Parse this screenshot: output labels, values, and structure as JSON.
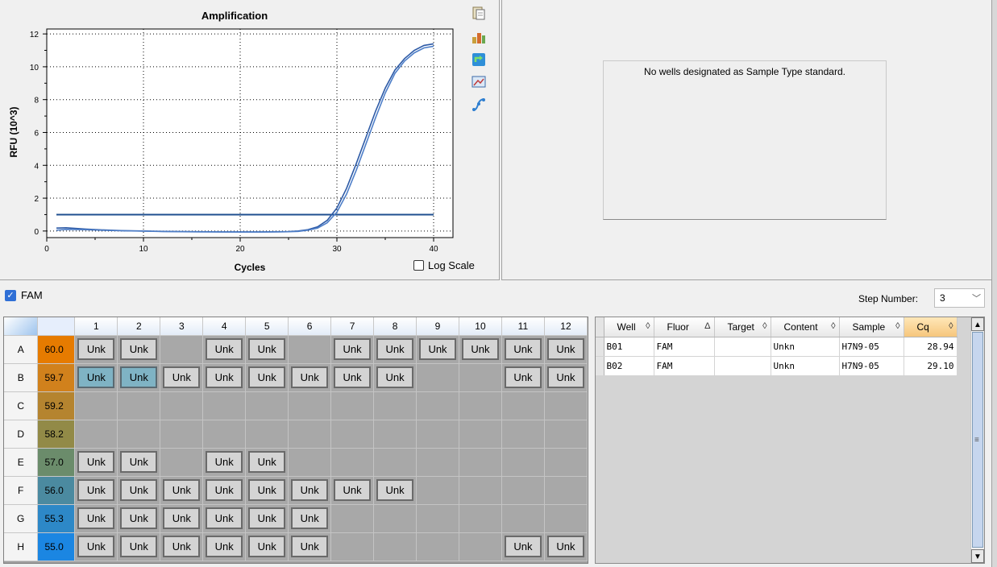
{
  "chart_data": {
    "type": "line",
    "title": "Amplification",
    "xlabel": "Cycles",
    "ylabel": "RFU (10^3)",
    "xlim": [
      0,
      42
    ],
    "ylim": [
      -0.4,
      12.3
    ],
    "xticks": [
      0,
      10,
      20,
      30,
      40
    ],
    "yticks": [
      0,
      2,
      4,
      6,
      8,
      10,
      12
    ],
    "grid": "dotted",
    "threshold": 1.0,
    "threshold_x": [
      1,
      40
    ],
    "series": [
      {
        "color": "#2d5aa6",
        "x": [
          1,
          2,
          4,
          6,
          8,
          10,
          12,
          14,
          16,
          18,
          20,
          22,
          24,
          25,
          26,
          27,
          28,
          29,
          30,
          31,
          32,
          33,
          34,
          35,
          36,
          37,
          38,
          39,
          40
        ],
        "values": [
          0.18,
          0.2,
          0.12,
          0.06,
          0.02,
          0.0,
          -0.02,
          -0.03,
          -0.04,
          -0.05,
          -0.05,
          -0.05,
          -0.04,
          -0.03,
          0.0,
          0.08,
          0.25,
          0.65,
          1.4,
          2.6,
          4.1,
          5.7,
          7.3,
          8.7,
          9.8,
          10.5,
          11.0,
          11.3,
          11.4
        ]
      },
      {
        "color": "#4f7fc8",
        "x": [
          1,
          2,
          4,
          6,
          8,
          10,
          12,
          14,
          16,
          18,
          20,
          22,
          24,
          25,
          26,
          27,
          28,
          29,
          30,
          31,
          32,
          33,
          34,
          35,
          36,
          37,
          38,
          39,
          40
        ],
        "values": [
          0.05,
          0.1,
          0.08,
          0.04,
          0.01,
          -0.01,
          -0.03,
          -0.04,
          -0.05,
          -0.05,
          -0.06,
          -0.06,
          -0.05,
          -0.04,
          -0.02,
          0.05,
          0.18,
          0.5,
          1.15,
          2.25,
          3.7,
          5.3,
          6.9,
          8.4,
          9.6,
          10.35,
          10.85,
          11.15,
          11.25
        ]
      }
    ]
  },
  "toolbar": {
    "icons": [
      "copy-icon",
      "export-icon",
      "refresh-icon",
      "image-icon",
      "curve-icon"
    ]
  },
  "log_scale_label": "Log Scale",
  "standard_curve": {
    "message": "No wells designated as Sample Type standard."
  },
  "fluor": {
    "label": "FAM",
    "checked": true
  },
  "step": {
    "label": "Step Number:",
    "value": "3"
  },
  "plate": {
    "columns": [
      "1",
      "2",
      "3",
      "4",
      "5",
      "6",
      "7",
      "8",
      "9",
      "10",
      "11",
      "12"
    ],
    "rows": [
      {
        "id": "A",
        "temp": "60.0",
        "temp_color": "#e67b00",
        "wells": [
          "Unk",
          "Unk",
          "",
          "Unk",
          "Unk",
          "",
          "Unk",
          "Unk",
          "Unk",
          "Unk",
          "Unk",
          "Unk"
        ],
        "selected": []
      },
      {
        "id": "B",
        "temp": "59.7",
        "temp_color": "#d1811c",
        "wells": [
          "Unk",
          "Unk",
          "Unk",
          "Unk",
          "Unk",
          "Unk",
          "Unk",
          "Unk",
          "",
          "",
          "Unk",
          "Unk"
        ],
        "selected": [
          0,
          1
        ]
      },
      {
        "id": "C",
        "temp": "59.2",
        "temp_color": "#b5842f",
        "wells": [
          "",
          "",
          "",
          "",
          "",
          "",
          "",
          "",
          "",
          "",
          "",
          ""
        ],
        "selected": []
      },
      {
        "id": "D",
        "temp": "58.2",
        "temp_color": "#928a47",
        "wells": [
          "",
          "",
          "",
          "",
          "",
          "",
          "",
          "",
          "",
          "",
          "",
          ""
        ],
        "selected": []
      },
      {
        "id": "E",
        "temp": "57.0",
        "temp_color": "#6b8c6b",
        "wells": [
          "Unk",
          "Unk",
          "",
          "Unk",
          "Unk",
          "",
          "",
          "",
          "",
          "",
          "",
          ""
        ],
        "selected": []
      },
      {
        "id": "F",
        "temp": "56.0",
        "temp_color": "#4b8aa0",
        "wells": [
          "Unk",
          "Unk",
          "Unk",
          "Unk",
          "Unk",
          "Unk",
          "Unk",
          "Unk",
          "",
          "",
          "",
          ""
        ],
        "selected": []
      },
      {
        "id": "G",
        "temp": "55.3",
        "temp_color": "#2d88c7",
        "wells": [
          "Unk",
          "Unk",
          "Unk",
          "Unk",
          "Unk",
          "Unk",
          "",
          "",
          "",
          "",
          "",
          ""
        ],
        "selected": []
      },
      {
        "id": "H",
        "temp": "55.0",
        "temp_color": "#1b86e2",
        "wells": [
          "Unk",
          "Unk",
          "Unk",
          "Unk",
          "Unk",
          "Unk",
          "",
          "",
          "",
          "",
          "Unk",
          "Unk"
        ],
        "selected": []
      }
    ]
  },
  "results": {
    "columns": [
      {
        "label": "Well",
        "sort": "◊"
      },
      {
        "label": "Fluor",
        "sort": "Δ"
      },
      {
        "label": "Target",
        "sort": "◊"
      },
      {
        "label": "Content",
        "sort": "◊"
      },
      {
        "label": "Sample",
        "sort": "◊"
      },
      {
        "label": "Cq",
        "sort": "◊"
      }
    ],
    "rows": [
      {
        "well": "B01",
        "fluor": "FAM",
        "target": "",
        "content": "Unkn",
        "sample": "H7N9-05",
        "cq": "28.94"
      },
      {
        "well": "B02",
        "fluor": "FAM",
        "target": "",
        "content": "Unkn",
        "sample": "H7N9-05",
        "cq": "29.10"
      }
    ]
  }
}
